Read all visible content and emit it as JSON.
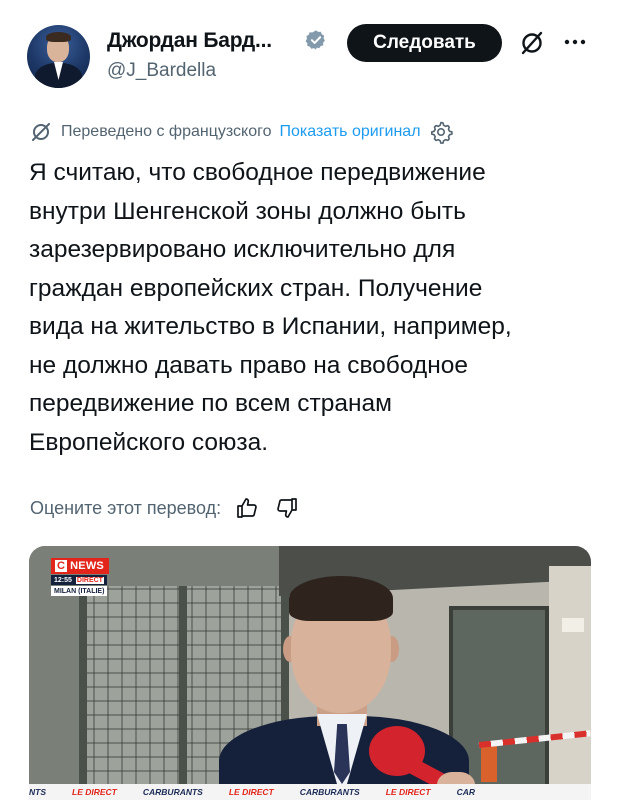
{
  "author": {
    "name": "Джордан Бард...",
    "handle": "@J_Bardella",
    "verified_badge": "verified-badge-icon",
    "follow_label": "Следовать",
    "colors": {
      "badge": "#829aab",
      "follow_bg": "#0f1419"
    }
  },
  "translation": {
    "label": "Переведено с французского",
    "show_original": "Показать оригинал",
    "icon": "translate-slash-icon",
    "settings_icon": "gear-icon"
  },
  "tweet": {
    "lines": [
      "Я считаю, что свободное передвижение",
      "внутри Шенгенской зоны должно быть",
      "зарезервировано исключительно для",
      "граждан европейских стран. Получение",
      "вида на жительство в Испании, например,",
      "не должно давать право на свободное",
      "передвижение по всем странам",
      "Европейского союза."
    ]
  },
  "rating": {
    "label": "Оцените этот перевод:",
    "like_icon": "thumbs-up-icon",
    "dislike_icon": "thumbs-down-icon"
  },
  "media": {
    "channel": "NEWS",
    "channel_prefix": "C",
    "time": "12:55",
    "direct": "DIRECT",
    "location": "MILAN (ITALIE)",
    "ticker": [
      "NTS",
      "LE DIRECT",
      "CARBURANTS",
      "LE DIRECT",
      "CARBURANTS",
      "LE DIRECT",
      "CAR"
    ]
  },
  "colors": {
    "text": "#0f1419",
    "secondary": "#536471",
    "link": "#1d9bf0"
  }
}
